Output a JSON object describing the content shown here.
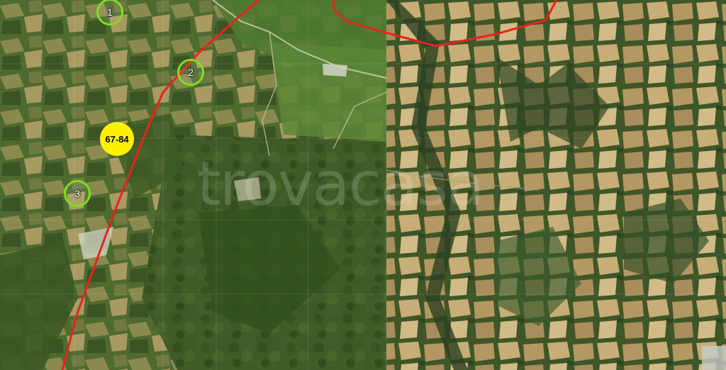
{
  "map": {
    "kind": "satellite",
    "watermark": "trovacasa",
    "colors": {
      "route": "#e8231d",
      "marker_ring": "#7fe01e",
      "cluster_fill": "#fff200",
      "forest": "#3f5a26",
      "field": "#b8a06a"
    }
  },
  "markers": [
    {
      "label": "1",
      "type": "listing-pin"
    },
    {
      "label": "2",
      "type": "listing-pin"
    },
    {
      "label": "3",
      "type": "listing-pin"
    }
  ],
  "cluster": {
    "label": "67-84",
    "type": "price-cluster"
  }
}
